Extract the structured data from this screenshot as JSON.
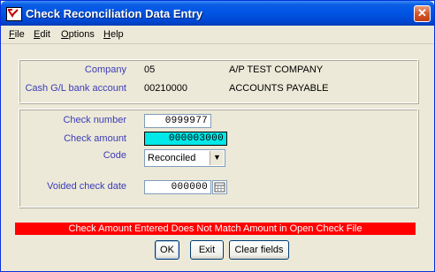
{
  "window": {
    "title": "Check Reconciliation Data Entry",
    "close_glyph": "✕"
  },
  "menu": [
    {
      "key": "F",
      "rest": "ile"
    },
    {
      "key": "E",
      "rest": "dit"
    },
    {
      "key": "O",
      "rest": "ptions"
    },
    {
      "key": "H",
      "rest": "elp"
    }
  ],
  "company": {
    "label": "Company",
    "code": "05",
    "name": "A/P TEST COMPANY"
  },
  "bank_account": {
    "label": "Cash G/L bank account",
    "code": "00210000",
    "name": "ACCOUNTS PAYABLE"
  },
  "check_number": {
    "label": "Check number",
    "value": "0999977"
  },
  "check_amount": {
    "label": "Check amount",
    "value": "000003000"
  },
  "code": {
    "label": "Code",
    "selected": "Reconciled"
  },
  "voided_date": {
    "label": "Voided check date",
    "value": "000000"
  },
  "error_message": "Check Amount Entered Does Not Match Amount in Open Check File",
  "buttons": {
    "ok": "OK",
    "exit": "Exit",
    "clear": "Clear fields"
  },
  "colors": {
    "label": "#3b3bb8",
    "highlight": "#00e8e8",
    "error_bg": "#ff0000",
    "title_bar": "#0054e3"
  },
  "icons": {
    "app": "app-icon",
    "close": "close-icon",
    "dropdown": "chevron-down-icon",
    "calendar": "calendar-icon"
  }
}
